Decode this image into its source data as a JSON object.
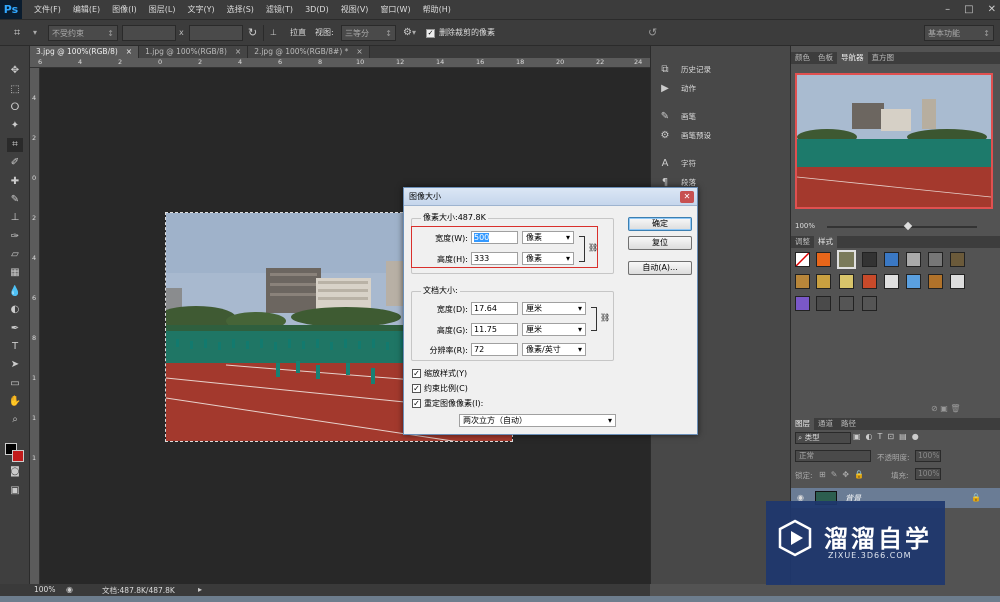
{
  "menubar": {
    "logo": "Ps",
    "items": [
      "文件(F)",
      "编辑(E)",
      "图像(I)",
      "图层(L)",
      "文字(Y)",
      "选择(S)",
      "滤镜(T)",
      "3D(D)",
      "视图(V)",
      "窗口(W)",
      "帮助(H)"
    ],
    "controls": [
      "–",
      "□",
      "✕"
    ]
  },
  "options_bar": {
    "ratio_select": "不受约束",
    "x_sep": "x",
    "straighten_label": "拉直",
    "view_label": "视图:",
    "view_value": "三等分",
    "delete_crop_label": "删除裁剪的像素",
    "workspace": "基本功能"
  },
  "tabs": [
    {
      "label": "3.jpg @ 100%(RGB/8)",
      "close": "×",
      "active": true
    },
    {
      "label": "1.jpg @ 100%(RGB/8)",
      "close": "×",
      "active": false
    },
    {
      "label": "2.jpg @ 100%(RGB/8#) *",
      "close": "×",
      "active": false
    }
  ],
  "ruler_top": [
    "6",
    "4",
    "2",
    "0",
    "2",
    "4",
    "6",
    "8",
    "10",
    "12",
    "14",
    "16",
    "18",
    "20",
    "22",
    "24"
  ],
  "ruler_left": [
    "4",
    "2",
    "0",
    "2",
    "4",
    "6",
    "8",
    "1",
    "1",
    "1"
  ],
  "status": {
    "zoom": "100%",
    "doc": "文档:487.8K/487.8K"
  },
  "mini_panel": [
    {
      "icon": "history-icon",
      "glyph": "⧉",
      "label": "历史记录"
    },
    {
      "icon": "actions-icon",
      "glyph": "▶",
      "label": "动作"
    },
    {
      "icon": "brush-icon",
      "glyph": "✎",
      "label": "画笔"
    },
    {
      "icon": "brush-presets-icon",
      "glyph": "⚙",
      "label": "画笔预设"
    },
    {
      "icon": "character-icon",
      "glyph": "A",
      "label": "字符"
    },
    {
      "icon": "paragraph-icon",
      "glyph": "¶",
      "label": "段落"
    }
  ],
  "right_panels": {
    "top_tabs": [
      "颜色",
      "色板",
      "导航器",
      "直方图"
    ],
    "nav_zoom": "100%",
    "style_tabs": [
      "调整",
      "样式"
    ],
    "layer_tabs": [
      "图层",
      "通道",
      "路径"
    ],
    "layer_kind": "类型",
    "blend_mode": "正常",
    "opacity_label": "不透明度:",
    "opacity_value": "100%",
    "lock_label": "锁定:",
    "fill_label": "填充:",
    "fill_value": "100%",
    "layer_name": "背景"
  },
  "dialog": {
    "title": "图像大小",
    "pixel_dims_label": "像素大小:487.8K",
    "width_label": "宽度(W):",
    "width_value": "500",
    "height_label": "高度(H):",
    "height_value": "333",
    "pixel_unit": "像素",
    "doc_size_label": "文档大小:",
    "doc_width_label": "宽度(D):",
    "doc_width_value": "17.64",
    "doc_height_label": "高度(G):",
    "doc_height_value": "11.75",
    "cm_unit": "厘米",
    "resolution_label": "分辨率(R):",
    "resolution_value": "72",
    "resolution_unit": "像素/英寸",
    "scale_styles": "缩放样式(Y)",
    "constrain": "约束比例(C)",
    "resample": "重定图像像素(I):",
    "resample_method": "两次立方（自动）",
    "ok": "确定",
    "reset": "复位",
    "auto": "自动(A)..."
  },
  "watermark": {
    "brand": "溜溜自学",
    "url": "ZIXUE.3D66.COM"
  },
  "colors": {
    "menubar": "#3c3c3c",
    "workspace": "#282828",
    "dialog_highlight": "#d9302c",
    "watermark": "#1e376e"
  }
}
